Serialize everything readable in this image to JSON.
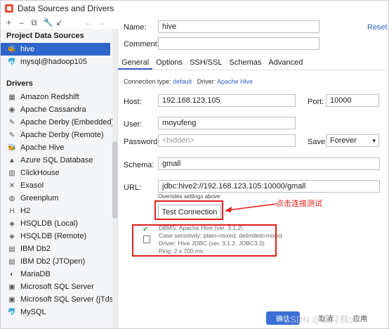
{
  "window": {
    "title": "Data Sources and Drivers"
  },
  "toolbar": {
    "add": "+",
    "remove": "–",
    "duplicate": "⧉",
    "settings": "🔧",
    "import": "↙",
    "back": "←",
    "forward": "→"
  },
  "sidebar": {
    "project_header": "Project Data Sources",
    "project_items": [
      {
        "label": "hive",
        "icon": "hive-icon"
      },
      {
        "label": "mysql@hadoop105",
        "icon": "mysql-icon"
      }
    ],
    "drivers_header": "Drivers",
    "drivers": [
      "Amazon Redshift",
      "Apache Cassandra",
      "Apache Derby (Embedded)",
      "Apache Derby (Remote)",
      "Apache Hive",
      "Azure SQL Database",
      "ClickHouse",
      "Exasol",
      "Greenplum",
      "H2",
      "HSQLDB (Local)",
      "HSQLDB (Remote)",
      "IBM Db2",
      "IBM Db2 (JTOpen)",
      "MariaDB",
      "Microsoft SQL Server",
      "Microsoft SQL Server (jTds)",
      "MySQL"
    ]
  },
  "main": {
    "name_label": "Name:",
    "name_value": "hive",
    "reset": "Reset",
    "comment_label": "Comment:",
    "tabs": [
      "General",
      "Options",
      "SSH/SSL",
      "Schemas",
      "Advanced"
    ],
    "connection_type_label": "Connection type:",
    "connection_type": "default",
    "driver_label": "Driver:",
    "driver": "Apache Hive",
    "host_label": "Host:",
    "host_value": "192.168.123.105",
    "port_label": "Port:",
    "port_value": "10000",
    "user_label": "User:",
    "user_value": "moyufeng",
    "password_label": "Password:",
    "password_value": "<hidden>",
    "save_label": "Save:",
    "save_value": "Forever",
    "schema_label": "Schema:",
    "schema_value": "gmall",
    "url_label": "URL:",
    "url_value": "jdbc:hive2://192.168.123.105:10000/gmall",
    "url_note": "Overrides settings above",
    "test_button": "Test Connection",
    "annotation": "点击连接测试",
    "status_lines": [
      "DBMS: Apache Hive (ver. 3.1.2)",
      "Case sensitivity: plain=mixed, delimited=mixed",
      "Driver: Hive JDBC (ver. 3.1.2, JDBC3.0)",
      "Ping: 2 s 700 ms"
    ]
  },
  "footer": {
    "ok": "确认",
    "cancel": "取消",
    "apply": "应用"
  },
  "watermark": "CSDN @三月枫火",
  "colors": {
    "accent": "#2f65ca",
    "annotation": "#e0201c",
    "success": "#3b9c3e"
  }
}
